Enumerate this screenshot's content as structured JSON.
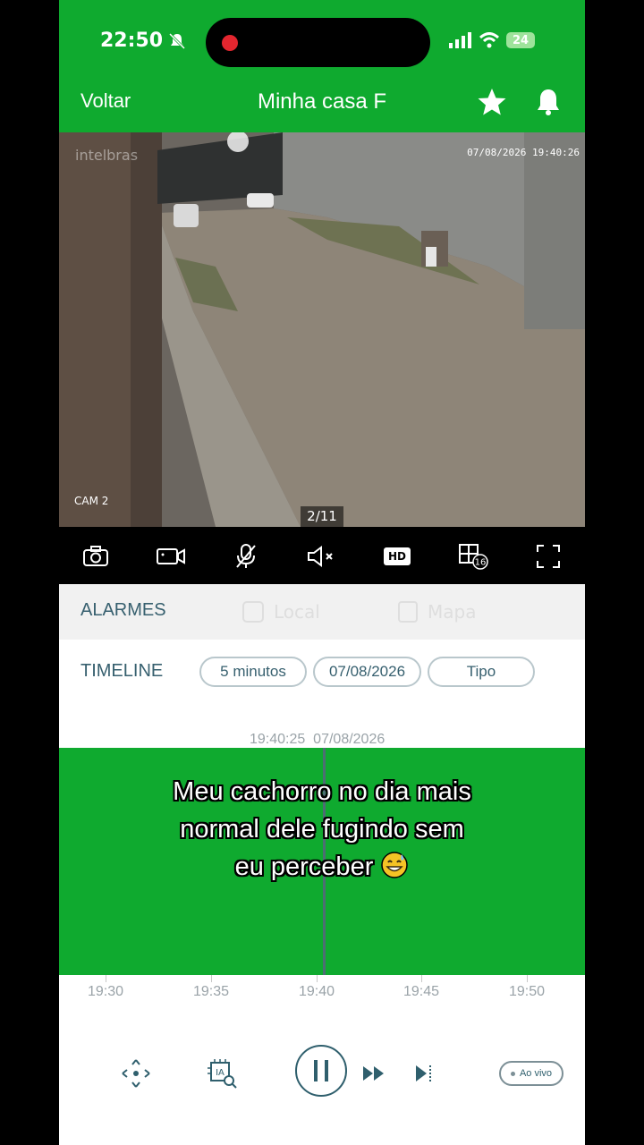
{
  "status": {
    "time": "22:50",
    "battery": "24"
  },
  "nav": {
    "back_label": "Voltar",
    "title": "Minha casa F"
  },
  "video": {
    "brand": "intelbras",
    "timestamp": "07/08/2026 19:40:26",
    "camera": "CAM 2",
    "page": "2/11"
  },
  "controls": {
    "hd_label": "HD",
    "layout_badge": "16"
  },
  "tabs": {
    "alarms": "ALARMES",
    "local": "Local",
    "mapa": "Mapa"
  },
  "timeline": {
    "label": "TIMELINE",
    "interval": "5 minutos",
    "date": "07/08/2026",
    "type": "Tipo",
    "cursor_time": "19:40:25",
    "cursor_date": "07/08/2026",
    "ticks": [
      "19:30",
      "19:35",
      "19:40",
      "19:45",
      "19:50"
    ]
  },
  "caption": {
    "line1": "Meu cachorro no dia mais",
    "line2": "normal dele fugindo sem",
    "line3": "eu perceber"
  },
  "playbar": {
    "live_label": "Ao vivo"
  },
  "colors": {
    "brand_green": "#0faa2f",
    "text_teal": "#37606f"
  }
}
